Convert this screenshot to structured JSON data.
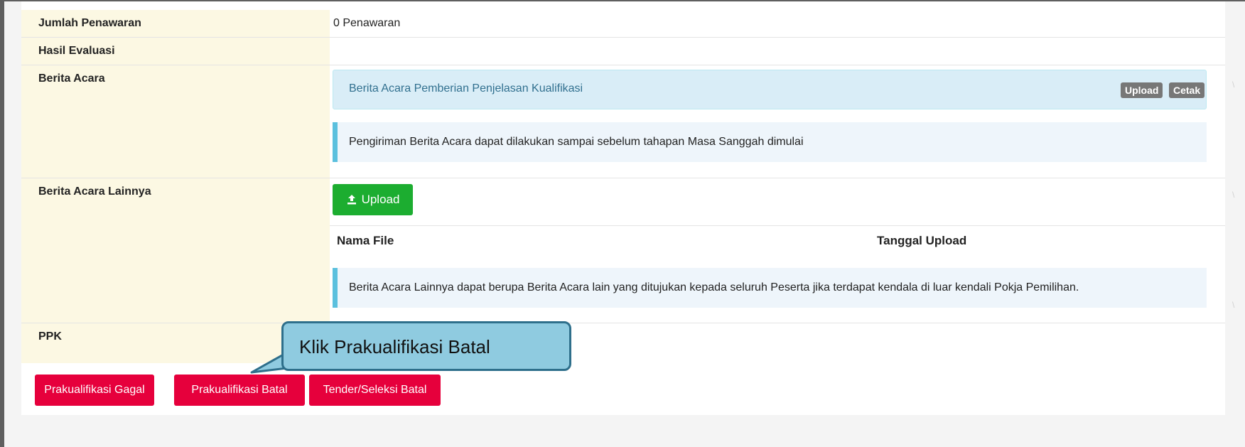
{
  "rows": {
    "jumlah_penawaran": {
      "label": "Jumlah Penawaran",
      "value": "0 Penawaran"
    },
    "hasil_evaluasi": {
      "label": "Hasil Evaluasi",
      "value": ""
    },
    "berita_acara": {
      "label": "Berita Acara",
      "doc_title": "Berita Acara Pemberian Penjelasan Kualifikasi",
      "upload_label": "Upload",
      "cetak_label": "Cetak",
      "note": "Pengiriman Berita Acara dapat dilakukan sampai sebelum tahapan Masa Sanggah dimulai"
    },
    "berita_acara_lainnya": {
      "label": "Berita Acara Lainnya",
      "upload_button": "Upload",
      "upload_icon": "upload-icon",
      "columns": [
        "Nama File",
        "Tanggal Upload"
      ],
      "note": "Berita Acara Lainnya dapat berupa Berita Acara lain yang ditujukan kepada seluruh Peserta jika terdapat kendala di luar kendali Pokja Pemilihan."
    },
    "ppk": {
      "label": "PPK",
      "value": ""
    }
  },
  "actions": {
    "prakualifikasi_gagal": "Prakualifikasi Gagal",
    "prakualifikasi_batal": "Prakualifikasi Batal",
    "tender_batal": "Tender/Seleksi Batal"
  },
  "callout": {
    "text": "Klik Prakualifikasi Batal"
  },
  "colors": {
    "danger": "#e6003c",
    "success": "#1cad30",
    "info_bg": "#d9edf7",
    "label_bg": "#fcf8e3",
    "callout_bg": "#8fcbe0"
  }
}
